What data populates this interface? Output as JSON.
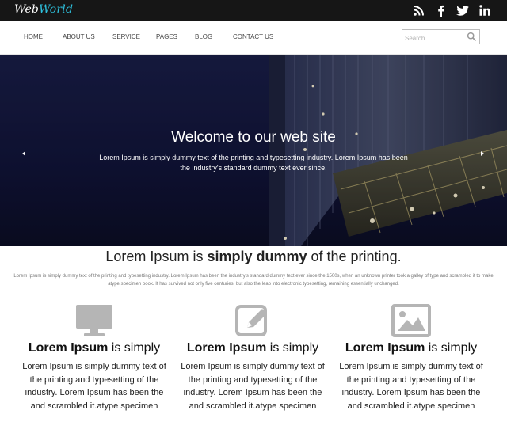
{
  "logo": {
    "part1": "Web",
    "part2": "World"
  },
  "social": [
    {
      "name": "rss-icon"
    },
    {
      "name": "facebook-icon"
    },
    {
      "name": "twitter-icon"
    },
    {
      "name": "linkedin-icon"
    }
  ],
  "nav": {
    "items": [
      "HOME",
      "ABOUT US",
      "SERVICE",
      "PAGES",
      "BLOG",
      "CONTACT US"
    ]
  },
  "search": {
    "placeholder": "Search"
  },
  "hero": {
    "title": "Welcome to our web site",
    "text": "Lorem Ipsum is simply dummy text of the printing and typesetting industry. Lorem Ipsum has been the industry's standard dummy text ever since.",
    "prev_arrow": "left-arrow-icon",
    "next_arrow": "right-arrow-icon"
  },
  "intro": {
    "title_pre": "Lorem Ipsum is ",
    "title_bold": "simply dummy",
    "title_post": " of the printing.",
    "text": "Lorem Ipsum is simply dummy text of the printing and typesetting industry. Lorem Ipsum has been the industry's standard dummy text ever since the 1500s, when an unknown printer took a galley of type and scrambled it to make atype specimen book. It has survived not only five centuries, but also the leap into electronic typesetting, remaining essentially unchanged."
  },
  "features": [
    {
      "icon": "monitor-icon",
      "title_bold": "Lorem Ipsum",
      "title_rest": " is simply",
      "text": "Lorem Ipsum is simply dummy text of the printing and typesetting of the industry. Lorem Ipsum has been the and scrambled it.atype specimen"
    },
    {
      "icon": "edit-icon",
      "title_bold": "Lorem Ipsum",
      "title_rest": " is simply",
      "text": "Lorem Ipsum is simply dummy text of the printing and typesetting of the industry. Lorem Ipsum has been the and scrambled it.atype specimen"
    },
    {
      "icon": "image-icon",
      "title_bold": "Lorem Ipsum",
      "title_rest": " is simply",
      "text": "Lorem Ipsum is simply dummy text of the printing and typesetting of the industry. Lorem Ipsum has been the and scrambled it.atype specimen"
    }
  ],
  "colors": {
    "topbar": "#161616",
    "logo_accent": "#2ec3e0",
    "hero_bg": "#141432",
    "icon_gray": "#b5b5b5"
  }
}
